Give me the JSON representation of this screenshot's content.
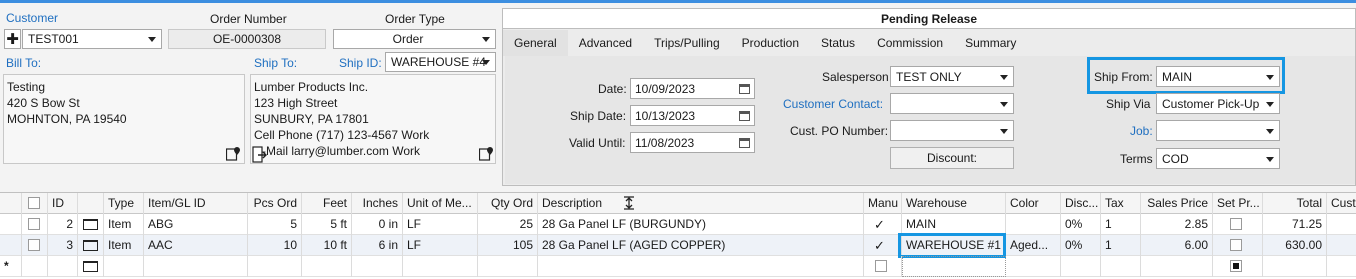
{
  "order": {
    "customer_label": "Customer",
    "customer_value": "TEST001",
    "order_number_label": "Order Number",
    "order_number_value": "OE-0000308",
    "order_type_label": "Order Type",
    "order_type_value": "Order",
    "bill_to_label": "Bill To:",
    "bill_to_text": "Testing\n420 S Bow St\nMOHNTON, PA 19540",
    "ship_to_label": "Ship To:",
    "ship_id_label": "Ship ID:",
    "ship_id_value": "WAREHOUSE #4",
    "ship_to_text": "Lumber Products Inc.\n123 High Street\nSUNBURY, PA 17801\nCell Phone (717) 123-4567 Work\nE-Mail larry@lumber.com Work"
  },
  "panel": {
    "title": "Pending Release",
    "tabs": [
      "General",
      "Advanced",
      "Trips/Pulling",
      "Production",
      "Status",
      "Commission",
      "Summary"
    ],
    "date_label": "Date:",
    "date_value": "10/09/2023",
    "ship_date_label": "Ship Date:",
    "ship_date_value": "10/13/2023",
    "valid_until_label": "Valid Until:",
    "valid_until_value": "11/08/2023",
    "salesperson_label": "Salesperson",
    "salesperson_value": "TEST ONLY",
    "customer_contact_label": "Customer Contact:",
    "customer_contact_value": "",
    "cust_po_label": "Cust. PO Number:",
    "cust_po_value": "",
    "discount_label": "Discount:",
    "ship_from_label": "Ship From:",
    "ship_from_value": "MAIN",
    "ship_via_label": "Ship Via",
    "ship_via_value": "Customer Pick-Up",
    "job_label": "Job:",
    "job_value": "",
    "terms_label": "Terms",
    "terms_value": "COD"
  },
  "grid": {
    "columns": {
      "id": "ID",
      "type": "Type",
      "item": "Item/GL ID",
      "pcs": "Pcs Ord",
      "feet": "Feet",
      "inches": "Inches",
      "uom": "Unit of Me...",
      "qty": "Qty Ord",
      "desc": "Description",
      "manu": "Manu",
      "warehouse": "Warehouse",
      "color": "Color",
      "disc": "Disc...",
      "tax": "Tax",
      "price": "Sales Price",
      "setpr": "Set Pr...",
      "total": "Total",
      "cust": "Cust"
    },
    "rows": [
      {
        "id": "2",
        "type": "Item",
        "item": "ABG",
        "pcs": "5",
        "feet": "5 ft",
        "inches": "0 in",
        "uom": "LF",
        "qty": "25",
        "desc": "28 Ga Panel LF (BURGUNDY)",
        "warehouse": "MAIN",
        "color": "",
        "disc": "0%",
        "tax": "1",
        "price": "2.85",
        "total": "71.25"
      },
      {
        "id": "3",
        "type": "Item",
        "item": "AAC",
        "pcs": "10",
        "feet": "10 ft",
        "inches": "6 in",
        "uom": "LF",
        "qty": "105",
        "desc": "28 Ga Panel LF (AGED COPPER)",
        "warehouse": "WAREHOUSE #1",
        "color": "Aged...",
        "disc": "0%",
        "tax": "1",
        "price": "6.00",
        "total": "630.00"
      }
    ]
  },
  "colors": {
    "accent": "#1f6fc0",
    "highlight": "#1596e2"
  }
}
